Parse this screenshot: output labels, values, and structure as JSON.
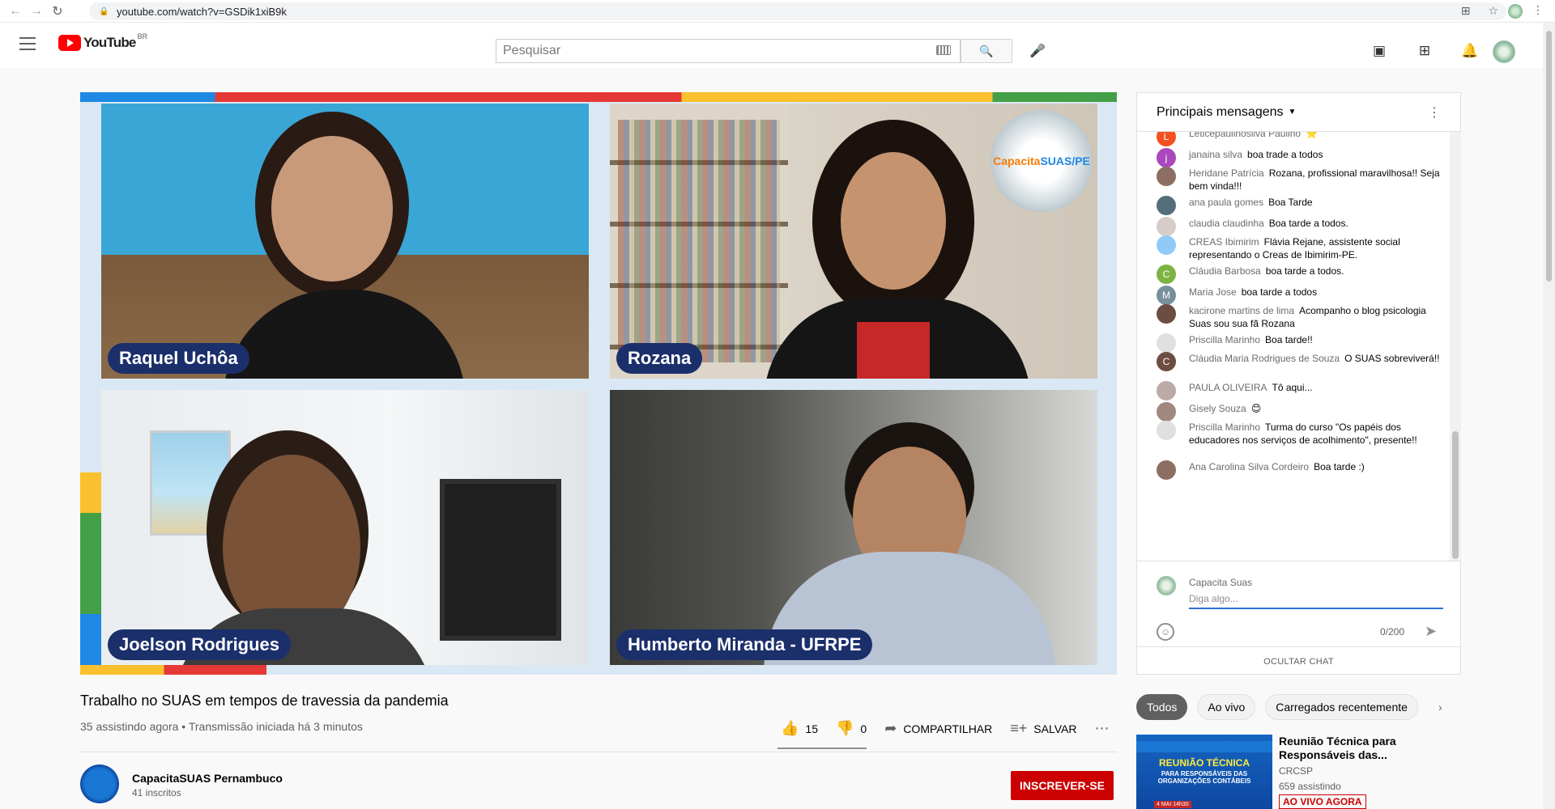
{
  "browser": {
    "url": "youtube.com/watch?v=GSDik1xiB9k"
  },
  "header": {
    "logo_text": "YouTube",
    "region": "BR",
    "search_placeholder": "Pesquisar"
  },
  "video": {
    "participants": [
      "Raquel Uchôa",
      "Rozana",
      "Joelson Rodrigues",
      "Humberto Miranda - UFRPE"
    ],
    "badge_text_a": "Capacita",
    "badge_text_b": "SUAS/PE",
    "title": "Trabalho no SUAS em tempos de travessia da pandemia",
    "meta": "35 assistindo agora • Transmissão iniciada há 3 minutos",
    "likes": "15",
    "dislikes": "0",
    "share_label": "COMPARTILHAR",
    "save_label": "SALVAR"
  },
  "channel": {
    "name": "CapacitaSUAS Pernambuco",
    "subscribers": "41 inscritos",
    "subscribe_label": "INSCREVER-SE"
  },
  "chat": {
    "header_title": "Principais mensagens",
    "messages": [
      {
        "author": "Leticepaulinosilva Paulino",
        "text": "⭐",
        "initial": "L",
        "color": "#f4511e"
      },
      {
        "author": "janaina silva",
        "text": "boa trade a todos",
        "initial": "j",
        "color": "#ab47bc"
      },
      {
        "author": "Heridane Patrícia",
        "text": "Rozana, profissional maravilhosa!! Seja bem vinda!!!",
        "initial": "",
        "color": "#8d6e63"
      },
      {
        "author": "ana paula gomes",
        "text": "Boa Tarde",
        "initial": "",
        "color": "#546e7a"
      },
      {
        "author": "claudia claudinha",
        "text": "Boa tarde a todos.",
        "initial": "",
        "color": "#d7ccc8"
      },
      {
        "author": "CREAS Ibimirim",
        "text": "Flávia Rejane, assistente social representando o Creas de Ibimirim-PE.",
        "initial": "",
        "color": "#90caf9"
      },
      {
        "author": "Cláudia Barbosa",
        "text": "boa tarde a todos.",
        "initial": "C",
        "color": "#7cb342"
      },
      {
        "author": "Maria Jose",
        "text": "boa tarde a todos",
        "initial": "M",
        "color": "#78909c"
      },
      {
        "author": "kacirone martins de lima",
        "text": "Acompanho o blog psicologia Suas sou sua fã Rozana",
        "initial": "",
        "color": "#6d4c41"
      },
      {
        "author": "Priscilla Marinho",
        "text": "Boa tarde!!",
        "initial": "",
        "color": "#e0e0e0"
      },
      {
        "author": "Cláudia Maria Rodrigues de Souza",
        "text": "O SUAS sobreviverá!!",
        "initial": "C",
        "color": "#6d4c41"
      },
      {
        "author": "PAULA OLIVEIRA",
        "text": "Tô aqui...",
        "initial": "",
        "color": "#bcaaa4"
      },
      {
        "author": "Gisely Souza",
        "text": "😊",
        "initial": "",
        "color": "#a1887f"
      },
      {
        "author": "Priscilla Marinho",
        "text": "Turma do curso \"Os papéis dos educadores nos serviços de acolhimento\", presente!!",
        "initial": "",
        "color": "#e0e0e0"
      },
      {
        "author": "Ana Carolina Silva Cordeiro",
        "text": "Boa tarde :)",
        "initial": "",
        "color": "#8d6e63"
      }
    ],
    "input_user": "Capacita Suas",
    "input_placeholder": "Diga algo...",
    "char_count": "0/200",
    "hide_label": "OCULTAR CHAT"
  },
  "chips": [
    "Todos",
    "Ao vivo",
    "Carregados recentemente"
  ],
  "related": {
    "thumb_line1": "REUNIÃO TÉCNICA",
    "thumb_line2": "PARA RESPONSÁVEIS DAS ORGANIZAÇÕES CONTÁBEIS",
    "thumb_line3": "4 MAI 14h30",
    "title": "Reunião Técnica para Responsáveis das...",
    "channel": "CRCSP",
    "viewers": "659 assistindo",
    "live_badge": "AO VIVO AGORA"
  }
}
